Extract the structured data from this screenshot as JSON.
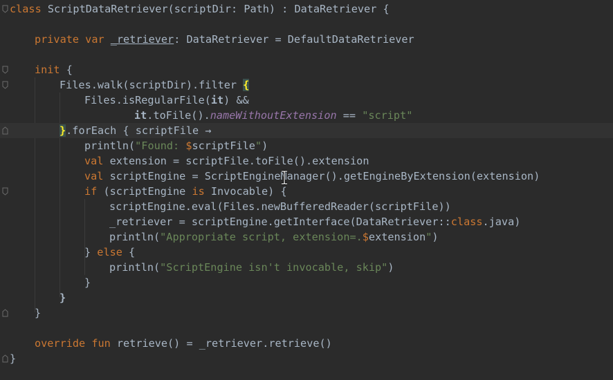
{
  "editor": {
    "language": "Kotlin",
    "colors": {
      "background": "#2b2b2b",
      "current_line": "#323232",
      "keyword": "#cc7832",
      "string": "#6a8759",
      "property": "#9876aa",
      "text": "#a9b7c6",
      "brace_highlight": "#ffef28"
    },
    "tokens": {
      "l1": [
        "class",
        " ScriptDataRetriever(scriptDir: Path) : DataRetriever {"
      ],
      "l3": [
        "private",
        " ",
        "var",
        " ",
        "_retriever",
        ": DataRetriever = DefaultDataRetriever"
      ],
      "l5": [
        "init",
        " {"
      ],
      "l6": [
        "Files.walk(scriptDir).filter ",
        "{"
      ],
      "l7": [
        "Files.isRegularFile(",
        "it",
        ") ",
        "&&"
      ],
      "l8": [
        "it",
        ".toFile().",
        "nameWithoutExtension",
        " ",
        "==",
        " ",
        "\"script\""
      ],
      "l9": [
        "}",
        ".forEach { scriptFile ",
        "→"
      ],
      "l10": [
        "println(",
        "\"Found: ",
        "$",
        "scriptFile",
        "\"",
        ")"
      ],
      "l11": [
        "val",
        " extension = scriptFile.toFile().extension"
      ],
      "l12": [
        "val",
        " scriptEngine = ScriptEngineManager().getEngineByExtension(extension)"
      ],
      "l13": [
        "if",
        " (scriptEngine ",
        "is",
        " Invocable) {"
      ],
      "l14": [
        "scriptEngine.eval(Files.newBufferedReader(scriptFile))"
      ],
      "l15": [
        "_retriever = scriptEngine.getInterface(DataRetriever",
        "::",
        "class",
        ".java)"
      ],
      "l16": [
        "println(",
        "\"Appropriate script, extension=.",
        "$",
        "extension",
        "\"",
        ")"
      ],
      "l17": [
        "} ",
        "else",
        " {"
      ],
      "l18": [
        "println(",
        "\"ScriptEngine isn't invocable, skip\"",
        ")"
      ],
      "l19": [
        "}"
      ],
      "l20": [
        "}"
      ],
      "l21": [
        "}"
      ],
      "l23": [
        "override",
        " ",
        "fun",
        " retrieve() = _retriever.retrieve()"
      ],
      "l24": [
        "}"
      ]
    }
  }
}
